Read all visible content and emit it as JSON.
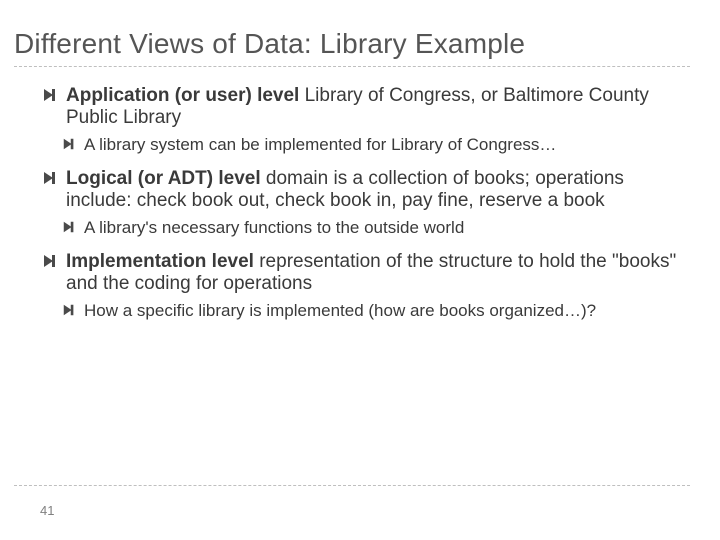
{
  "title": "Different Views of Data: Library Example",
  "items": [
    {
      "bold": "Application (or user) level",
      "rest": " Library of Congress, or Baltimore County Public Library",
      "sub": "A library system can be implemented for Library of Congress…"
    },
    {
      "bold": "Logical (or ADT) level",
      "rest": " domain is a collection of books; operations include: check book out, check book in, pay fine, reserve a book",
      "sub": "A library's necessary functions to the outside world"
    },
    {
      "bold": "Implementation level",
      "rest": " representation of the structure to hold the \"books\" and the coding for operations",
      "sub": "How a specific library is implemented (how are books organized…)?"
    }
  ],
  "page_number": "41"
}
